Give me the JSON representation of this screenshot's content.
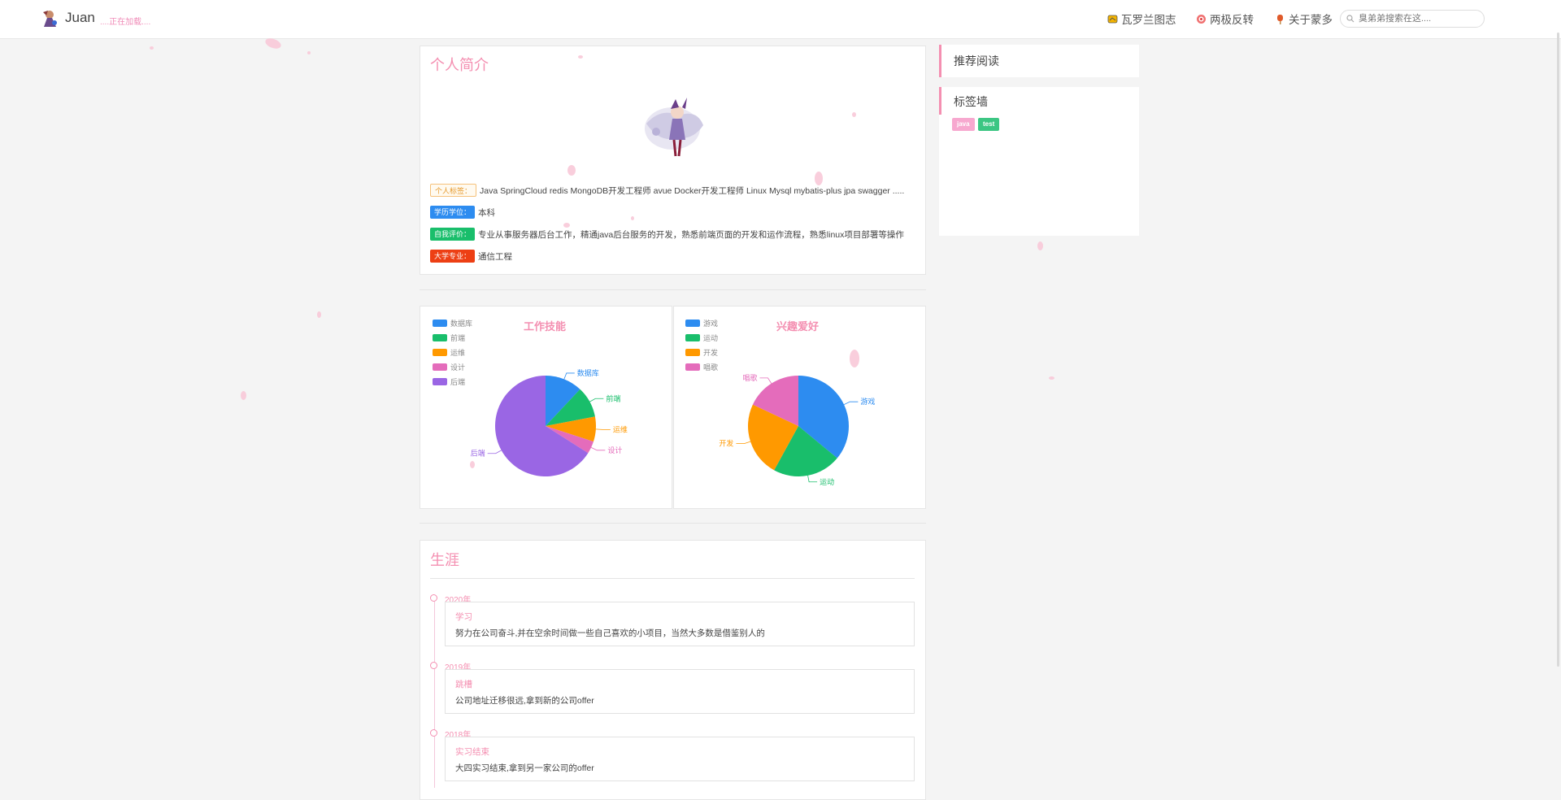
{
  "header": {
    "brand": "Juan",
    "brand_sub": "....正在加载....",
    "nav": [
      {
        "label": "瓦罗兰图志",
        "icon": "map-icon"
      },
      {
        "label": "两极反转",
        "icon": "target-icon"
      },
      {
        "label": "关于蒙多",
        "icon": "popsicle-icon"
      }
    ],
    "search_placeholder": "臭弟弟搜索在这...."
  },
  "profile": {
    "title": "个人简介",
    "rows": [
      {
        "tag": "个人标签：",
        "text": "Java SpringCloud redis MongoDB开发工程师 avue Docker开发工程师 Linux Mysql mybatis-plus jpa swagger ....."
      },
      {
        "tag": "学历学位：",
        "text": "本科"
      },
      {
        "tag": "自我评价：",
        "text": "专业从事服务器后台工作，精通java后台服务的开发，熟悉前端页面的开发和运作流程，熟悉linux项目部署等操作"
      },
      {
        "tag": "大学专业：",
        "text": "通信工程"
      }
    ]
  },
  "sidebar": {
    "recommended": "推荐阅读",
    "tag_wall": "标签墙",
    "tags": [
      "java",
      "test"
    ]
  },
  "chart_data": [
    {
      "type": "pie",
      "title": "工作技能",
      "categories": [
        "数据库",
        "前端",
        "运维",
        "设计",
        "后端"
      ],
      "values": [
        12,
        10,
        8,
        4,
        66
      ],
      "colors": [
        "#2d8cf0",
        "#19be6b",
        "#ff9900",
        "#e46cbb",
        "#9a66e4"
      ],
      "legend": "top-left"
    },
    {
      "type": "pie",
      "title": "兴趣爱好",
      "categories": [
        "游戏",
        "运动",
        "开发",
        "唱歌"
      ],
      "values": [
        36,
        22,
        24,
        18
      ],
      "colors": [
        "#2d8cf0",
        "#19be6b",
        "#ff9900",
        "#e46cbb"
      ],
      "legend": "top-left"
    }
  ],
  "career": {
    "title": "生涯",
    "items": [
      {
        "year": "2020年",
        "title": "学习",
        "desc": "努力在公司奋斗,并在空余时间做一些自己喜欢的小项目，当然大多数是借鉴别人的"
      },
      {
        "year": "2019年",
        "title": "跳槽",
        "desc": "公司地址迁移很远,拿到新的公司offer"
      },
      {
        "year": "2018年",
        "title": "实习结束",
        "desc": "大四实习结束,拿到另一家公司的offer"
      }
    ]
  }
}
